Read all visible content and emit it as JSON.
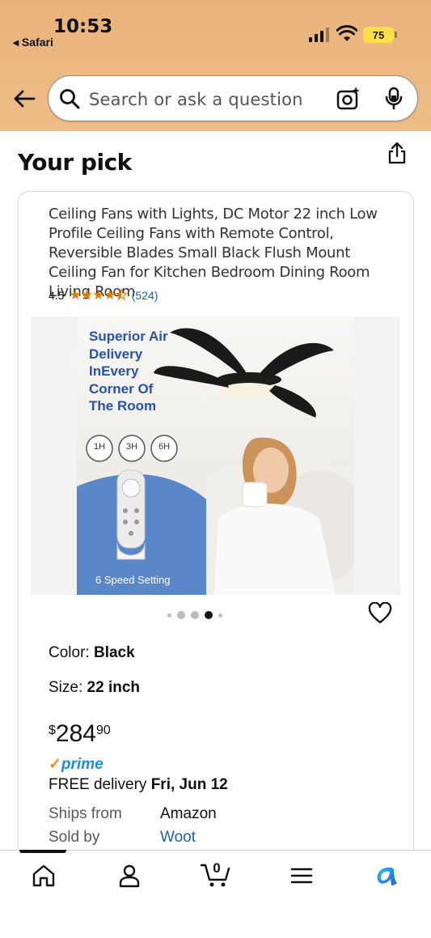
{
  "status": {
    "time": "10:53",
    "back_app": "◂ Safari",
    "battery": "75"
  },
  "search": {
    "placeholder": "Search or ask a question"
  },
  "page": {
    "heading": "Your pick"
  },
  "product": {
    "title": "Ceiling Fans with Lights, DC Motor 22 inch Low Profile Ceiling Fans with Remote Control, Reversible Blades Small Black Flush Mount Ceiling Fan for Kitchen Bedroom Dining Room Living Room",
    "rating": "4.5",
    "stars": 4.5,
    "review_count": "(524)",
    "image_text": {
      "headline": "Superior Air Delivery InEvery Corner Of The Room",
      "timers": [
        "1H",
        "3H",
        "6H"
      ],
      "caption": "6 Speed Setting"
    },
    "carousel": {
      "count": 5,
      "active_index": 3
    },
    "color_label": "Color: ",
    "color_value": "Black",
    "size_label": "Size: ",
    "size_value": "22 inch",
    "price_symbol": "$",
    "price_whole": "284",
    "price_cents": "90",
    "prime_label": "prime",
    "delivery_prefix": "FREE delivery ",
    "delivery_date": "Fri, Jun 12",
    "ships_from_label": "Ships from",
    "ships_from_value": "Amazon",
    "sold_by_label": "Sold by",
    "sold_by_value": "Woot"
  },
  "colors": {
    "header": "#efbd88",
    "star": "#e67a00",
    "link": "#2162a1",
    "prime": "#1a8fd6",
    "battery": "#fde047"
  },
  "bottom_nav": [
    "home-icon",
    "account-icon",
    "cart-icon",
    "menu-icon",
    "rufus-icon"
  ],
  "cart_count": "0"
}
